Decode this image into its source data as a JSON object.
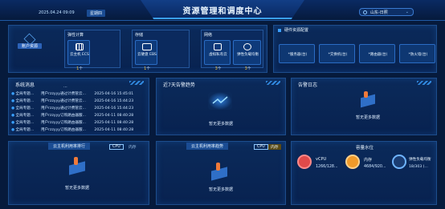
{
  "header": {
    "title": "资源管理和调度中心",
    "date": "2025.04.24 09:09",
    "weekday": "星期四",
    "region": "山东-日照"
  },
  "account": {
    "badge": "账户资源",
    "groups": [
      {
        "title": "弹性计算",
        "items": [
          {
            "name": "云主机 ECS",
            "value": "1",
            "unit": "个"
          }
        ]
      },
      {
        "title": "存储",
        "items": [
          {
            "name": "云硬盘 EBS",
            "value": "1",
            "unit": "个"
          }
        ]
      },
      {
        "title": "网络",
        "items": [
          {
            "name": "虚拟私有云",
            "value": "3",
            "unit": "个"
          },
          {
            "name": "弹性负载均衡",
            "value": "3",
            "unit": "个"
          }
        ]
      }
    ]
  },
  "hardware": {
    "title": "硬件资源配置",
    "items": [
      "*服务器(台)",
      "*交换机(台)",
      "*路由器(台)",
      "*防火墙(台)"
    ]
  },
  "logs": {
    "title": "系统消息",
    "more": "...",
    "rows": [
      {
        "type": "全局专题...",
        "msg": "用户rzzyyy通过计费管云...",
        "time": "2025-04-16 15:45:01"
      },
      {
        "type": "全局专题...",
        "msg": "用户rzzyyy通过计费管云...",
        "time": "2025-04-16 15:44:23"
      },
      {
        "type": "全局专题...",
        "msg": "用户rzzyyy通过计费管云...",
        "time": "2025-04-16 15:44:23"
      },
      {
        "type": "全局专题...",
        "msg": "用户rzzyyy订购路由器服...",
        "time": "2025-04-11 08:40:28"
      },
      {
        "type": "全局专题...",
        "msg": "用户rzzyyy订购路由器服...",
        "time": "2025-04-11 08:40:28"
      },
      {
        "type": "全局专题...",
        "msg": "用户rzzyyy订购路由器服...",
        "time": "2025-04-11 08:40:28"
      }
    ]
  },
  "alarm_trend": {
    "title": "近7天告警趋势",
    "empty": "暂无更多数据"
  },
  "alarm_log": {
    "title": "告警日志",
    "empty": "暂无更多数据"
  },
  "host_rank": {
    "title": "云主机利用率排行",
    "tabs": [
      "CPU",
      "内存"
    ],
    "empty": "暂无更多数据"
  },
  "host_trend": {
    "title": "云主机利用率趋势",
    "tabs": [
      "CPU",
      "内存"
    ],
    "empty": "暂无更多数据"
  },
  "capacity": {
    "title": "容量水位",
    "items": [
      {
        "label": "vCPU",
        "value": "1266/128..."
      },
      {
        "label": "内存",
        "value": "4684/920..."
      },
      {
        "label": "弹性负载均衡",
        "value": "18/303 (..."
      }
    ]
  }
}
